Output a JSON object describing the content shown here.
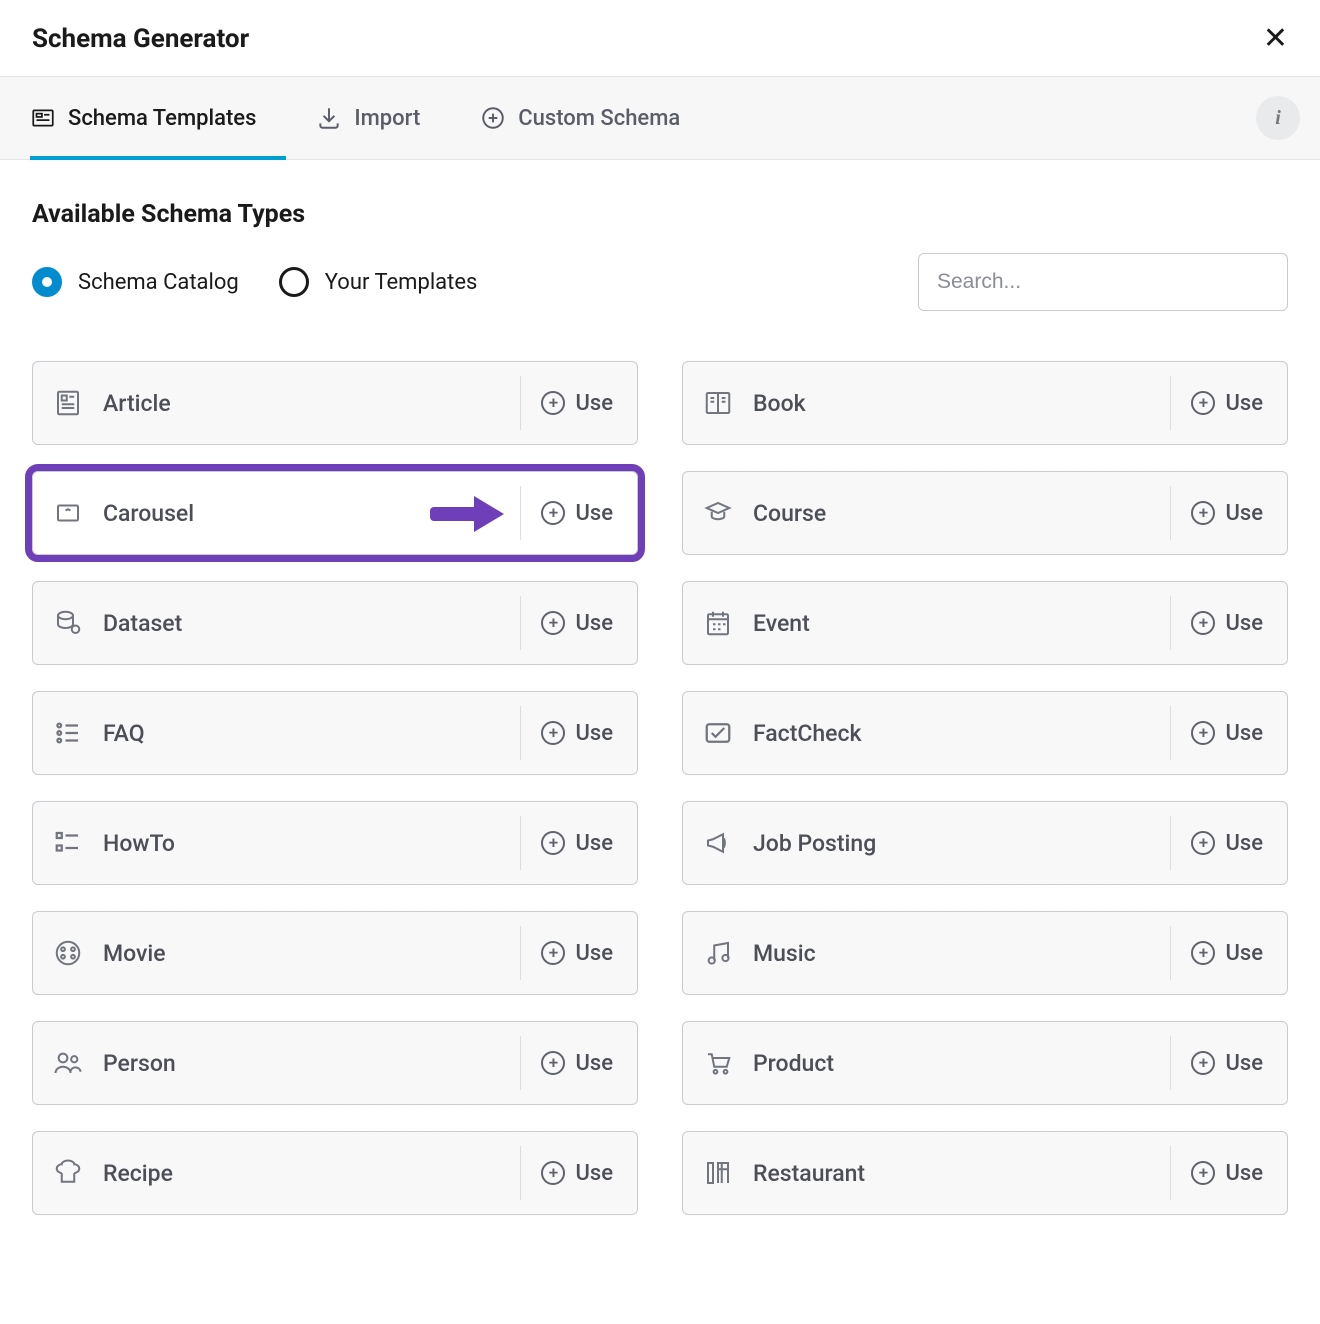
{
  "modal": {
    "title": "Schema Generator"
  },
  "tabs": {
    "templates": "Schema Templates",
    "import": "Import",
    "custom": "Custom Schema"
  },
  "section": {
    "title": "Available Schema Types"
  },
  "radios": {
    "catalog": "Schema Catalog",
    "your": "Your Templates"
  },
  "search": {
    "placeholder": "Search..."
  },
  "use_label": "Use",
  "cards": {
    "article": "Article",
    "book": "Book",
    "carousel": "Carousel",
    "course": "Course",
    "dataset": "Dataset",
    "event": "Event",
    "faq": "FAQ",
    "factcheck": "FactCheck",
    "howto": "HowTo",
    "jobposting": "Job Posting",
    "movie": "Movie",
    "music": "Music",
    "person": "Person",
    "product": "Product",
    "recipe": "Recipe",
    "restaurant": "Restaurant"
  }
}
